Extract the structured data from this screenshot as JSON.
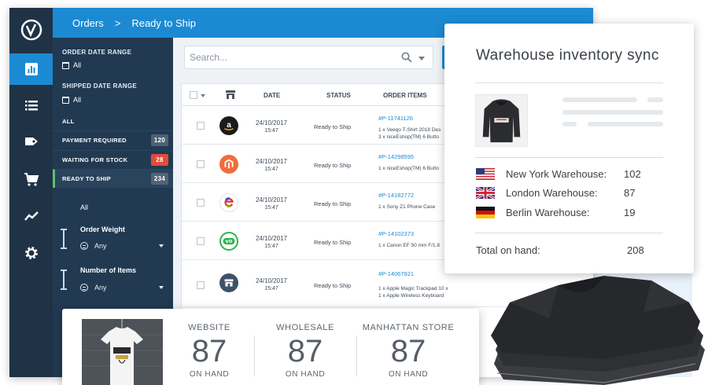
{
  "colors": {
    "brand_blue": "#1c8ad3",
    "rail": "#1f3246",
    "filter_panel": "#213a52",
    "ready_green": "#5cc16a",
    "badge_red": "#e34b3c"
  },
  "breadcrumb": {
    "root": "Orders",
    "separator": ">",
    "current": "Ready to Ship"
  },
  "rail_icons": [
    "logo",
    "dashboard-icon",
    "list-icon",
    "tag-icon",
    "cart-icon",
    "trend-icon",
    "gear-icon"
  ],
  "filters": {
    "order_date_label": "ORDER DATE RANGE",
    "order_date_value": "All",
    "shipped_date_label": "SHIPPED DATE RANGE",
    "shipped_date_value": "All",
    "all_label": "ALL",
    "statuses": [
      {
        "label": "PAYMENT REQUIRED",
        "count": "120"
      },
      {
        "label": "WAITING FOR STOCK",
        "count": "28"
      },
      {
        "label": "READY TO SHIP",
        "count": "234"
      }
    ],
    "sub_all": "All",
    "order_weight_label": "Order Weight",
    "order_weight_value": "Any",
    "num_items_label": "Number of Items",
    "num_items_value": "Any"
  },
  "search": {
    "placeholder": "Search..."
  },
  "table": {
    "headers": {
      "date": "DATE",
      "status": "STATUS",
      "order_items": "ORDER ITEMS"
    },
    "rows": [
      {
        "channel": "amazon-icon",
        "date": "24/10/2017",
        "time": "15:47",
        "status": "Ready to Ship",
        "order_id": "#P-11741126",
        "items": [
          "1 x Veeqo T-Shirt 2018 Des",
          "3 x niceEshop(TM) 6 Butto"
        ]
      },
      {
        "channel": "magento-icon",
        "date": "24/10/2017",
        "time": "15:47",
        "status": "Ready to Ship",
        "order_id": "#P-14298595",
        "items": [
          "1 x niceEshop(TM) 6 Butto"
        ]
      },
      {
        "channel": "ebay-icon",
        "date": "24/10/2017",
        "time": "15:47",
        "status": "Ready to Ship",
        "order_id": "#P-14182772",
        "items": [
          "1 x Sony Z1 Phone Case"
        ]
      },
      {
        "channel": "vend-icon",
        "date": "24/10/2017",
        "time": "15:47",
        "status": "Ready to Ship",
        "order_id": "#P-14102373",
        "items": [
          "1 x Canon EF 50 mm F/1.8"
        ]
      },
      {
        "channel": "store-icon",
        "date": "24/10/2017",
        "time": "15:47",
        "status": "Ready to Ship",
        "order_id": "#P-14067921",
        "items": [
          "1 x Apple Magic Trackpad 10 x",
          "1 x Apple Wireless Keyboard"
        ]
      }
    ]
  },
  "sync_card": {
    "title": "Warehouse inventory sync",
    "warehouses": [
      {
        "name": "New York Warehouse:",
        "qty": "102",
        "flag": "us-flag-icon"
      },
      {
        "name": "London Warehouse:",
        "qty": "87",
        "flag": "uk-flag-icon"
      },
      {
        "name": "Berlin Warehouse:",
        "qty": "19",
        "flag": "de-flag-icon"
      }
    ],
    "total_label": "Total on hand:",
    "total_value": "208"
  },
  "stock_card": {
    "columns": [
      {
        "label": "WEBSITE",
        "value": "87",
        "sub": "ON HAND"
      },
      {
        "label": "WHOLESALE",
        "value": "87",
        "sub": "ON HAND"
      },
      {
        "label": "MANHATTAN STORE",
        "value": "87",
        "sub": "ON HAND"
      }
    ]
  }
}
